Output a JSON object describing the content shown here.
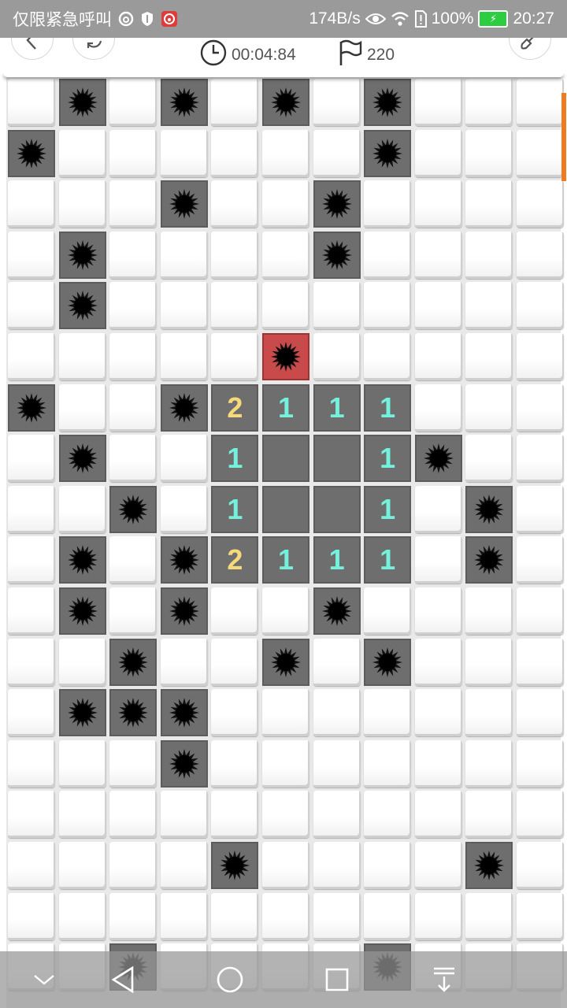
{
  "status_bar": {
    "carrier_text": "仅限紧急呼叫",
    "network_speed": "174B/s",
    "battery_percent": "100%",
    "time": "20:27"
  },
  "toolbar": {
    "timer": "00:04:84",
    "flags_remaining": "220",
    "icons": [
      "back-icon",
      "restart-icon",
      "clock-icon",
      "flag-icon",
      "shovel-icon"
    ]
  },
  "board": {
    "columns": 11,
    "visible_rows": 18,
    "legend": "C = covered, M = revealed mine, X = exploded mine, E = revealed empty, 1/2 = revealed number",
    "rows": [
      [
        "C",
        "M",
        "C",
        "M",
        "C",
        "M",
        "C",
        "M",
        "C",
        "C",
        "C"
      ],
      [
        "M",
        "C",
        "C",
        "C",
        "C",
        "C",
        "C",
        "M",
        "C",
        "C",
        "C"
      ],
      [
        "C",
        "C",
        "C",
        "M",
        "C",
        "C",
        "M",
        "C",
        "C",
        "C",
        "C"
      ],
      [
        "C",
        "M",
        "C",
        "C",
        "C",
        "C",
        "M",
        "C",
        "C",
        "C",
        "C"
      ],
      [
        "C",
        "M",
        "C",
        "C",
        "C",
        "C",
        "C",
        "C",
        "C",
        "C",
        "C"
      ],
      [
        "C",
        "C",
        "C",
        "C",
        "C",
        "X",
        "C",
        "C",
        "C",
        "C",
        "C"
      ],
      [
        "M",
        "C",
        "C",
        "M",
        "2",
        "1",
        "1",
        "1",
        "C",
        "C",
        "C"
      ],
      [
        "C",
        "M",
        "C",
        "C",
        "1",
        "E",
        "E",
        "1",
        "M",
        "C",
        "C"
      ],
      [
        "C",
        "C",
        "M",
        "C",
        "1",
        "E",
        "E",
        "1",
        "C",
        "M",
        "C"
      ],
      [
        "C",
        "M",
        "C",
        "M",
        "2",
        "1",
        "1",
        "1",
        "C",
        "M",
        "C"
      ],
      [
        "C",
        "M",
        "C",
        "M",
        "C",
        "C",
        "M",
        "C",
        "C",
        "C",
        "C"
      ],
      [
        "C",
        "C",
        "M",
        "C",
        "C",
        "M",
        "C",
        "M",
        "C",
        "C",
        "C"
      ],
      [
        "C",
        "M",
        "M",
        "M",
        "C",
        "C",
        "C",
        "C",
        "C",
        "C",
        "C"
      ],
      [
        "C",
        "C",
        "C",
        "M",
        "C",
        "C",
        "C",
        "C",
        "C",
        "C",
        "C"
      ],
      [
        "C",
        "C",
        "C",
        "C",
        "C",
        "C",
        "C",
        "C",
        "C",
        "C",
        "C"
      ],
      [
        "C",
        "C",
        "C",
        "C",
        "M",
        "C",
        "C",
        "C",
        "C",
        "M",
        "C"
      ],
      [
        "C",
        "C",
        "C",
        "C",
        "C",
        "C",
        "C",
        "C",
        "C",
        "C",
        "C"
      ],
      [
        "C",
        "C",
        "M",
        "C",
        "C",
        "C",
        "C",
        "M",
        "C",
        "C",
        "C"
      ]
    ]
  },
  "colors": {
    "number_1": "#74f0dc",
    "number_2": "#f5d97a",
    "exploded": "#c94a4a",
    "revealed": "#6e6e6e",
    "scroll_accent": "#f07a20"
  },
  "nav_bar": {
    "icons": [
      "collapse-icon",
      "back-triangle-icon",
      "home-circle-icon",
      "recents-square-icon",
      "notification-pull-icon"
    ]
  }
}
